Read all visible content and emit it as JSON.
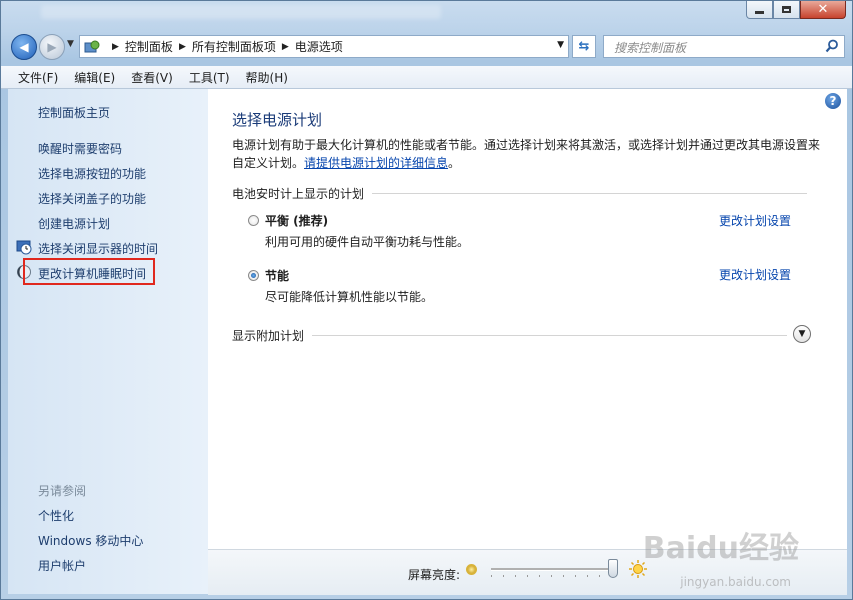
{
  "window": {
    "blurred_title": "https://www.baidu.com"
  },
  "nav": {
    "breadcrumbs": [
      "控制面板",
      "所有控制面板项",
      "电源选项"
    ],
    "search_placeholder": "搜索控制面板"
  },
  "menu": [
    "文件(F)",
    "编辑(E)",
    "查看(V)",
    "工具(T)",
    "帮助(H)"
  ],
  "sidebar": {
    "home": "控制面板主页",
    "tasks": [
      {
        "label": "唤醒时需要密码",
        "icon": ""
      },
      {
        "label": "选择电源按钮的功能",
        "icon": ""
      },
      {
        "label": "选择关闭盖子的功能",
        "icon": ""
      },
      {
        "label": "创建电源计划",
        "icon": ""
      },
      {
        "label": "选择关闭显示器的时间",
        "icon": "clock-icon"
      },
      {
        "label": "更改计算机睡眠时间",
        "icon": "moon-icon"
      }
    ],
    "see_also_title": "另请参阅",
    "see_also": [
      "个性化",
      "Windows 移动中心",
      "用户帐户"
    ]
  },
  "main": {
    "title": "选择电源计划",
    "description": "电源计划有助于最大化计算机的性能或者节能。通过选择计划来将其激活，或选择计划并通过更改其电源设置来自定义计划。",
    "description_link": "请提供电源计划的详细信息",
    "description_end": "。",
    "section_battery": "电池安时计上显示的计划",
    "plans": [
      {
        "name": "平衡 (推荐)",
        "desc": "利用可用的硬件自动平衡功耗与性能。",
        "link": "更改计划设置",
        "selected": false
      },
      {
        "name": "节能",
        "desc": "尽可能降低计算机性能以节能。",
        "link": "更改计划设置",
        "selected": true
      }
    ],
    "section_more": "显示附加计划"
  },
  "footer": {
    "brightness_label": "屏幕亮度:",
    "brightness_value": 1.0
  },
  "watermark": {
    "logo": "Baidu经验",
    "url": "jingyan.baidu.com"
  },
  "colors": {
    "highlight_box": "#e0281e",
    "link": "#0645ad",
    "title": "#1a3b78"
  }
}
